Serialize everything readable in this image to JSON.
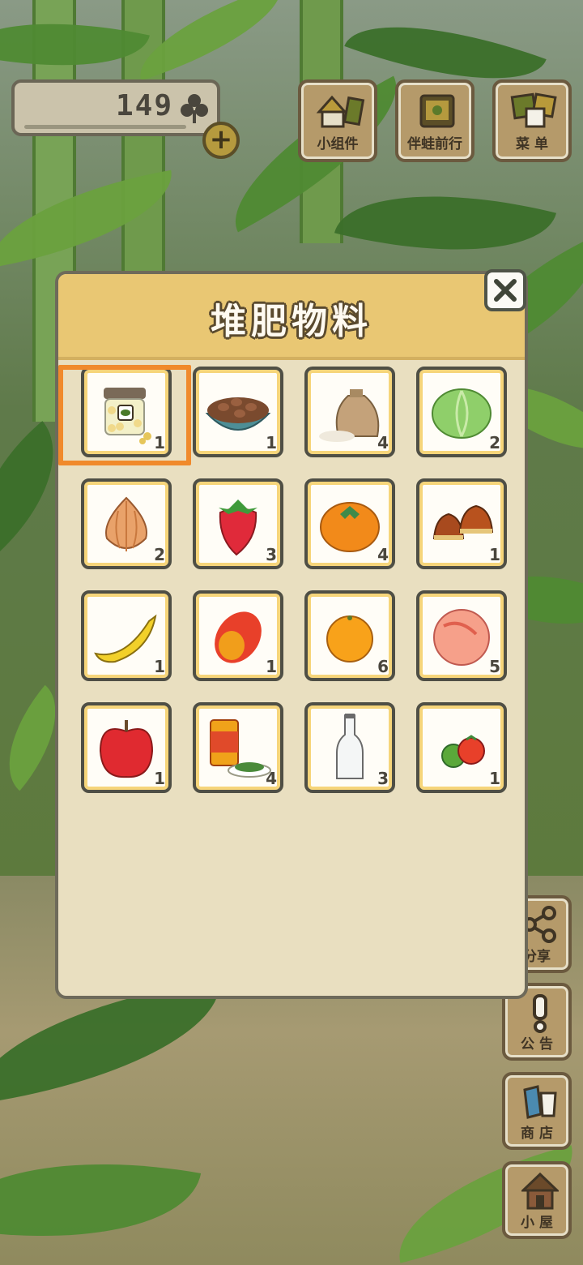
{
  "header": {
    "clover_count": "149"
  },
  "top_buttons": [
    {
      "label": "小组件",
      "icon": "widget-icon"
    },
    {
      "label": "伴蛙前行",
      "icon": "frog-travel-icon"
    },
    {
      "label": "菜 单",
      "icon": "menu-icon"
    }
  ],
  "side_buttons": [
    {
      "label": "分享",
      "icon": "share-icon"
    },
    {
      "label": "公 告",
      "icon": "notice-icon"
    },
    {
      "label": "商 店",
      "icon": "shop-icon"
    },
    {
      "label": "小 屋",
      "icon": "house-icon"
    }
  ],
  "panel": {
    "title": "堆肥物料",
    "items": [
      {
        "icon": "jar-icon",
        "qty": "1",
        "selected": true
      },
      {
        "icon": "beans-bowl-icon",
        "qty": "1"
      },
      {
        "icon": "rice-sack-icon",
        "qty": "4"
      },
      {
        "icon": "cabbage-icon",
        "qty": "2"
      },
      {
        "icon": "onion-icon",
        "qty": "2"
      },
      {
        "icon": "strawberry-icon",
        "qty": "3"
      },
      {
        "icon": "persimmon-icon",
        "qty": "4"
      },
      {
        "icon": "chestnut-icon",
        "qty": "1"
      },
      {
        "icon": "banana-icon",
        "qty": "1"
      },
      {
        "icon": "mango-icon",
        "qty": "1"
      },
      {
        "icon": "mandarin-icon",
        "qty": "6"
      },
      {
        "icon": "peach-icon",
        "qty": "5"
      },
      {
        "icon": "apple-icon",
        "qty": "1"
      },
      {
        "icon": "tea-can-icon",
        "qty": "4"
      },
      {
        "icon": "glass-bottle-icon",
        "qty": "3"
      },
      {
        "icon": "tomato-icon",
        "qty": "1"
      }
    ]
  },
  "colors": {
    "highlight": "#f08a2c",
    "panel_header": "#e9c773",
    "panel_bg": "#e9dfc0"
  }
}
